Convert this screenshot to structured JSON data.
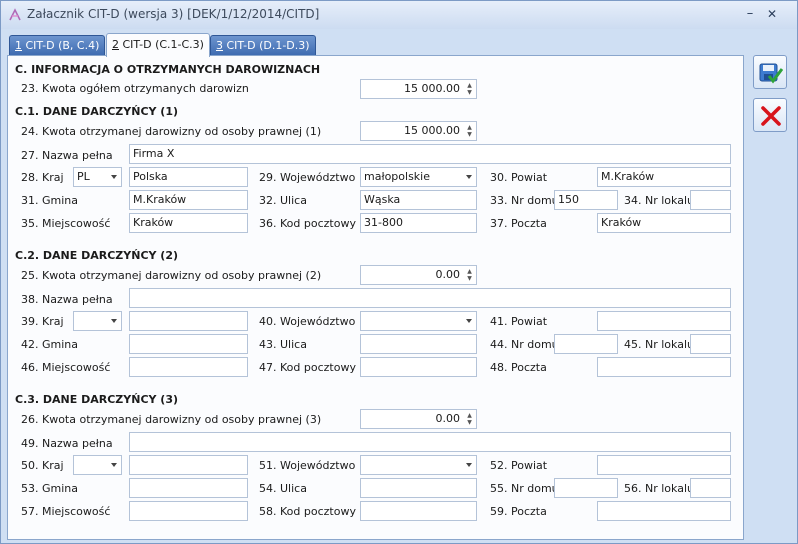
{
  "window": {
    "title": "Załacznik CIT-D (wersja 3) [DEK/1/12/2014/CITD]",
    "min_glyph": "–",
    "close_glyph": "✕"
  },
  "tabs": [
    {
      "key": "1",
      "label": " CIT-D (B, C.4)",
      "active": false
    },
    {
      "key": "2",
      "label": " CIT-D (C.1-C.3)",
      "active": true
    },
    {
      "key": "3",
      "label": " CIT-D (D.1-D.3)",
      "active": false
    }
  ],
  "section_c": {
    "header": "C. INFORMACJA O OTRZYMANYCH DAROWIZNACH",
    "total_label": "23. Kwota ogółem otrzymanych darowizn",
    "total_value": "15 000.00"
  },
  "donors": [
    {
      "header": "C.1. DANE DARCZYŃCY (1)",
      "amount_label": "24. Kwota otrzymanej darowizny od osoby prawnej (1)",
      "amount_value": "15 000.00",
      "name_label": "27. Nazwa pełna",
      "name_value": "Firma X",
      "country_label": "28. Kraj",
      "country_code": "PL",
      "country_value": "Polska",
      "voivodeship_label": "29. Województwo",
      "voivodeship_value": "małopolskie",
      "county_label": "30. Powiat",
      "county_value": "M.Kraków",
      "commune_label": "31. Gmina",
      "commune_value": "M.Kraków",
      "street_label": "32. Ulica",
      "street_value": "Wąska",
      "house_label": "33. Nr domu",
      "house_value": "150",
      "flat_label": "34. Nr lokalu",
      "flat_value": "",
      "city_label": "35. Miejscowość",
      "city_value": "Kraków",
      "postcode_label": "36. Kod pocztowy",
      "postcode_value": "31-800",
      "post_label": "37. Poczta",
      "post_value": "Kraków"
    },
    {
      "header": "C.2. DANE DARCZYŃCY (2)",
      "amount_label": "25. Kwota otrzymanej darowizny od osoby prawnej (2)",
      "amount_value": "0.00",
      "name_label": "38. Nazwa pełna",
      "name_value": "",
      "country_label": "39. Kraj",
      "country_code": "",
      "country_value": "",
      "voivodeship_label": "40. Województwo",
      "voivodeship_value": "",
      "county_label": "41. Powiat",
      "county_value": "",
      "commune_label": "42. Gmina",
      "commune_value": "",
      "street_label": "43. Ulica",
      "street_value": "",
      "house_label": "44. Nr domu",
      "house_value": "",
      "flat_label": "45. Nr lokalu",
      "flat_value": "",
      "city_label": "46. Miejscowość",
      "city_value": "",
      "postcode_label": "47. Kod pocztowy",
      "postcode_value": "",
      "post_label": "48. Poczta",
      "post_value": ""
    },
    {
      "header": "C.3. DANE DARCZYŃCY (3)",
      "amount_label": "26. Kwota otrzymanej darowizny od osoby prawnej (3)",
      "amount_value": "0.00",
      "name_label": "49. Nazwa pełna",
      "name_value": "",
      "country_label": "50. Kraj",
      "country_code": "",
      "country_value": "",
      "voivodeship_label": "51. Województwo",
      "voivodeship_value": "",
      "county_label": "52. Powiat",
      "county_value": "",
      "commune_label": "53. Gmina",
      "commune_value": "",
      "street_label": "54. Ulica",
      "street_value": "",
      "house_label": "55. Nr domu",
      "house_value": "",
      "flat_label": "56. Nr lokalu",
      "flat_value": "",
      "city_label": "57. Miejscowość",
      "city_value": "",
      "postcode_label": "58. Kod pocztowy",
      "postcode_value": "",
      "post_label": "59. Poczta",
      "post_value": ""
    }
  ],
  "actions": {
    "save_icon": "save-confirm-icon",
    "cancel_icon": "cancel-x-icon"
  },
  "colors": {
    "accent": "#3f6cb1",
    "save_green": "#2ea33a",
    "cancel_red": "#d8141c"
  }
}
